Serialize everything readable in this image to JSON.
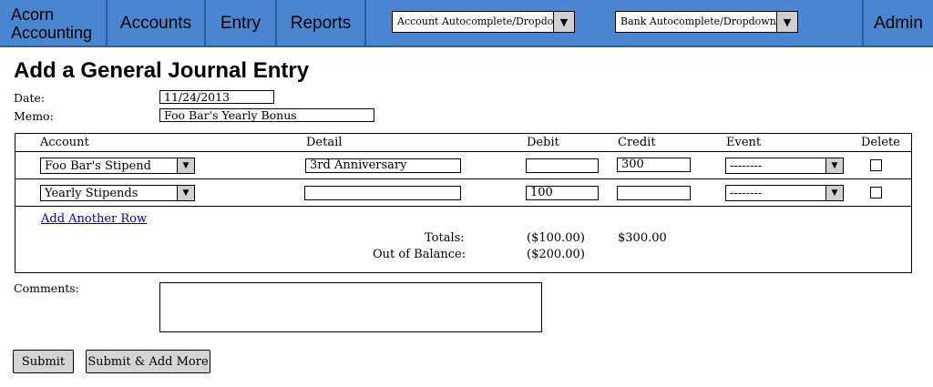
{
  "nav": {
    "brand_line1": "Acorn",
    "brand_line2": "Accounting",
    "items": [
      {
        "label": "Accounts"
      },
      {
        "label": "Entry"
      },
      {
        "label": "Reports"
      }
    ],
    "account_dropdown": "Account Autocomplete/Dropdown",
    "bank_dropdown": "Bank Autocomplete/Dropdown",
    "admin": "Admin"
  },
  "page": {
    "title": "Add a General Journal Entry",
    "date_label": "Date:",
    "date_value": "11/24/2013",
    "memo_label": "Memo:",
    "memo_value": "Foo Bar's Yearly Bonus"
  },
  "table": {
    "headers": [
      "Account",
      "Detail",
      "Debit",
      "Credit",
      "Event",
      "Delete"
    ],
    "rows": [
      {
        "account": "Foo Bar's Stipend",
        "detail": "3rd Anniversary",
        "debit": "",
        "credit": "300",
        "event": "--------"
      },
      {
        "account": "Yearly Stipends",
        "detail": "",
        "debit": "100",
        "credit": "",
        "event": "--------"
      }
    ],
    "add_row": "Add Another Row",
    "totals_label": "Totals:",
    "totals_debit": "($100.00)",
    "totals_credit": "$300.00",
    "out_of_balance_label": "Out of Balance:",
    "out_of_balance_value": "($200.00)"
  },
  "comments_label": "Comments:",
  "buttons": {
    "submit": "Submit",
    "submit_add_more": "Submit & Add More"
  },
  "icons": {
    "dropdown": "triangle-down-icon"
  },
  "colors": {
    "nav_bg": "#4a86d0",
    "nav_border": "#2d5e9e",
    "button_bg": "#d4d4d4",
    "link": "#0000cc"
  }
}
